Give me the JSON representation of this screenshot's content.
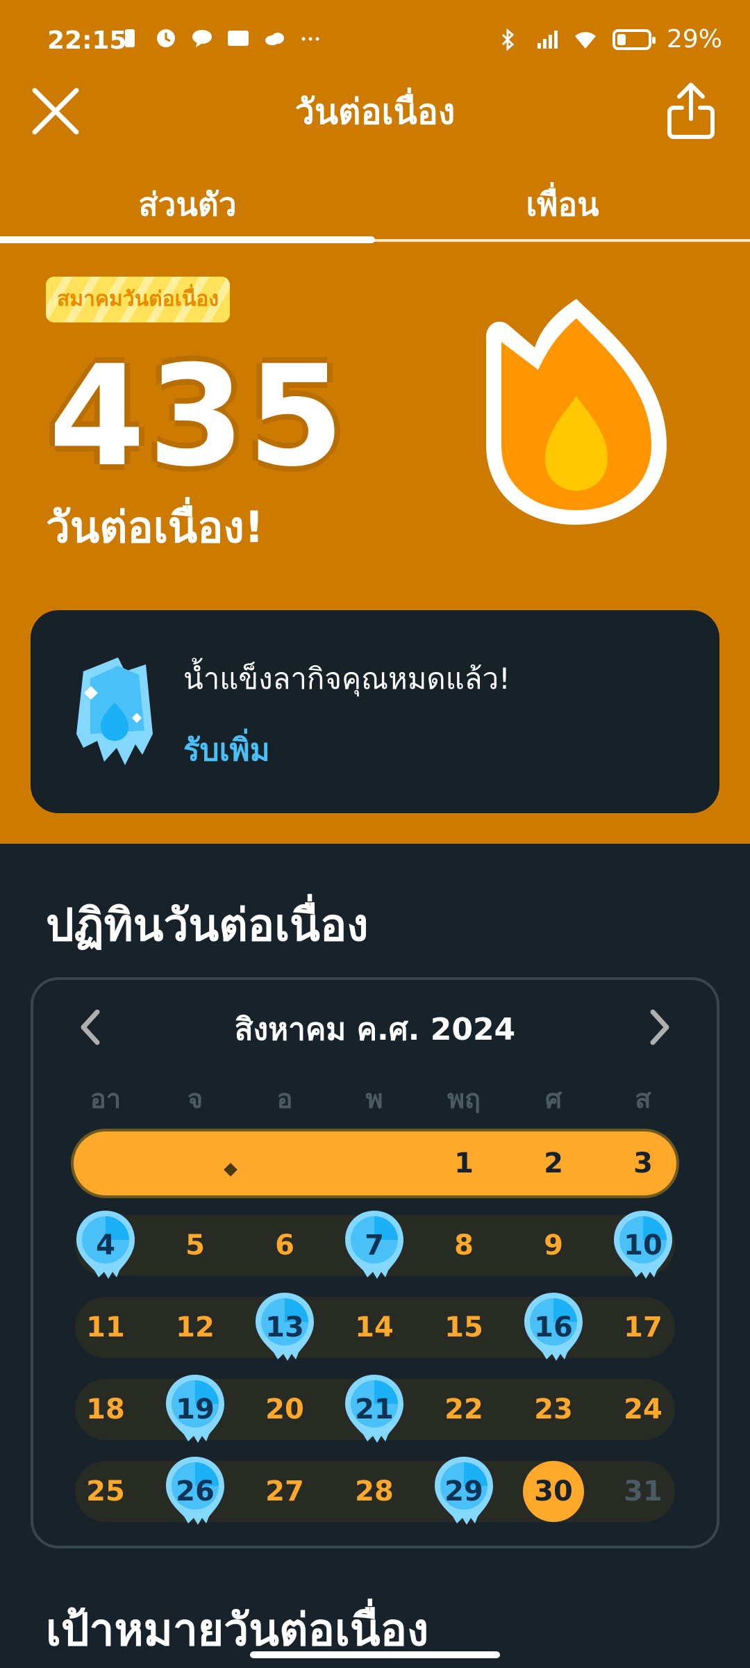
{
  "status_bar": {
    "time": "22:15",
    "battery": "29%"
  },
  "header": {
    "title": "วันต่อเนื่อง"
  },
  "tabs": [
    {
      "label": "ส่วนตัว",
      "active": true
    },
    {
      "label": "เพื่อน",
      "active": false
    }
  ],
  "streak": {
    "club_badge": "สมาคมวันต่อเนื่อง",
    "count": "435",
    "label": "วันต่อเนื่อง!"
  },
  "freeze_card": {
    "message": "น้ำแข็งลากิจคุณหมดแล้ว!",
    "link": "รับเพิ่ม"
  },
  "calendar": {
    "section_title": "ปฏิทินวันต่อเนื่อง",
    "month_label": "สิงหาคม ค.ศ. 2024",
    "weekdays": [
      "อา",
      "จ",
      "อ",
      "พ",
      "พฤ",
      "ศ",
      "ส"
    ],
    "weeks": [
      [
        "",
        "",
        "",
        "",
        "1",
        "2",
        "3"
      ],
      [
        "4",
        "5",
        "6",
        "7",
        "8",
        "9",
        "10"
      ],
      [
        "11",
        "12",
        "13",
        "14",
        "15",
        "16",
        "17"
      ],
      [
        "18",
        "19",
        "20",
        "21",
        "22",
        "23",
        "24"
      ],
      [
        "25",
        "26",
        "27",
        "28",
        "29",
        "30",
        "31"
      ]
    ],
    "freeze_days": [
      "4",
      "7",
      "10",
      "13",
      "16",
      "19",
      "21",
      "26",
      "29"
    ],
    "today": "30",
    "future_days": [
      "31"
    ]
  },
  "goal": {
    "section_title": "เป้าหมายวันต่อเนื่อง"
  },
  "colors": {
    "top_bg": "#cc7a00",
    "page_bg": "#17222a",
    "accent_orange": "#ffa92c",
    "freeze_blue": "#49c0f8"
  }
}
